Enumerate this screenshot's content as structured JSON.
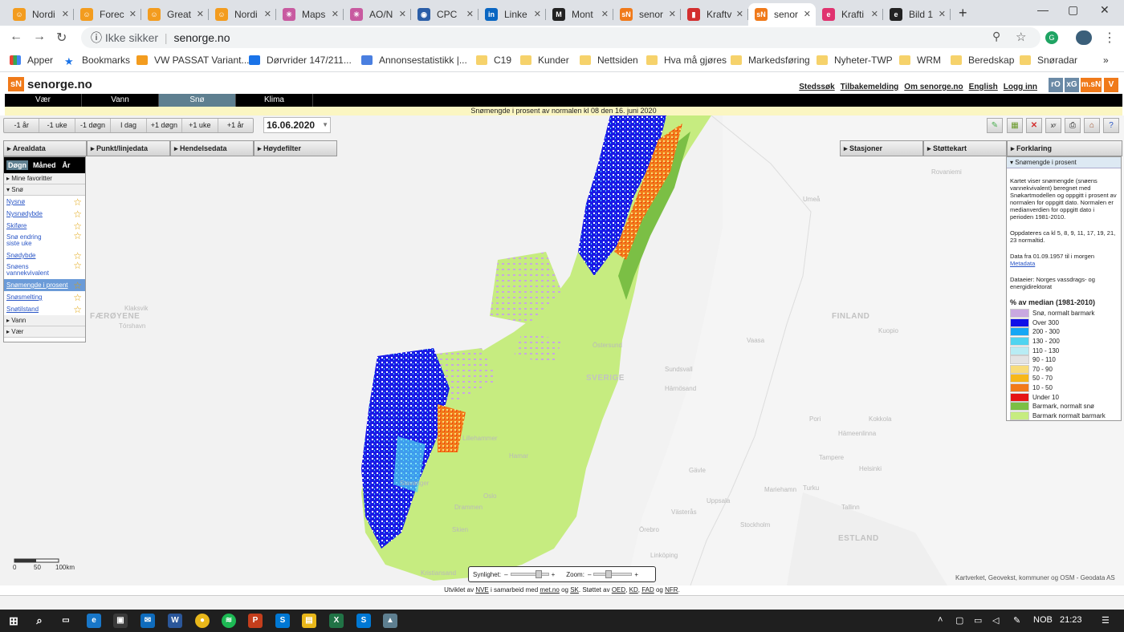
{
  "browser": {
    "tabs": [
      {
        "label": "Nordi",
        "color": "#f39c1f",
        "glyph": "☺"
      },
      {
        "label": "Forec",
        "color": "#f39c1f",
        "glyph": "☺"
      },
      {
        "label": "Great",
        "color": "#f39c1f",
        "glyph": "☺"
      },
      {
        "label": "Nordi",
        "color": "#f39c1f",
        "glyph": "☺"
      },
      {
        "label": "Maps",
        "color": "#c85aa0",
        "glyph": "✳"
      },
      {
        "label": "AO/N",
        "color": "#c85aa0",
        "glyph": "✳"
      },
      {
        "label": "CPC",
        "color": "#2b5ea7",
        "glyph": "◉"
      },
      {
        "label": "Linke",
        "color": "#0a66c2",
        "glyph": "in"
      },
      {
        "label": "Mont",
        "color": "#222222",
        "glyph": "M"
      },
      {
        "label": "senor",
        "color": "#f07a1a",
        "glyph": "sN"
      },
      {
        "label": "Kraftv",
        "color": "#d32f2f",
        "glyph": "▮"
      },
      {
        "label": "senor",
        "color": "#f07a1a",
        "glyph": "sN",
        "active": true
      },
      {
        "label": "Krafti",
        "color": "#e0326f",
        "glyph": "e"
      },
      {
        "label": "Bild 1",
        "color": "#222222",
        "glyph": "e"
      }
    ],
    "new_tab": "+",
    "url_warning": "Ikke sikker",
    "url": "senorge.no",
    "bookmarks": [
      {
        "label": "Apper",
        "kind": "apps"
      },
      {
        "label": "Bookmarks",
        "kind": "star"
      },
      {
        "label": "VW PASSAT Variant...",
        "kind": "E"
      },
      {
        "label": "Dørvrider 147/211...",
        "kind": "blue"
      },
      {
        "label": "Annonsestatistikk |...",
        "kind": "blue2"
      },
      {
        "label": "C19",
        "kind": "folder"
      },
      {
        "label": "Kunder",
        "kind": "folder"
      },
      {
        "label": "Nettsiden",
        "kind": "folder"
      },
      {
        "label": "Hva må gjøres",
        "kind": "folder"
      },
      {
        "label": "Markedsføring",
        "kind": "folder"
      },
      {
        "label": "Nyheter-TWP",
        "kind": "folder"
      },
      {
        "label": "WRM",
        "kind": "folder"
      },
      {
        "label": "Beredskap",
        "kind": "folder"
      },
      {
        "label": "Snøradar",
        "kind": "folder"
      }
    ],
    "more_bookmarks": "»"
  },
  "site": {
    "logo_text": "senorge.no",
    "logo_badge": "sN",
    "top_links": [
      "Stedssøk",
      "Tilbakemelding",
      "Om senorge.no",
      "English",
      "Logg inn"
    ],
    "brand_boxes": [
      {
        "label": "rO",
        "color": "#6b8aa6"
      },
      {
        "label": "xG",
        "color": "#6b8aa6"
      },
      {
        "label": "m.sN",
        "color": "#f07a1a"
      },
      {
        "label": "V",
        "color": "#f07a1a"
      }
    ],
    "main_nav": [
      "Vær",
      "Vann",
      "Snø",
      "Klima"
    ],
    "active_nav": "Snø",
    "info_bar": "Snømengde i prosent av normalen kl 08  den 16. juni 2020",
    "date_buttons": [
      "-1 år",
      "-1 uke",
      "-1 døgn",
      "I dag",
      "+1 døgn",
      "+1 uke",
      "+1 år"
    ],
    "date_value": "16.06.2020",
    "left_tabs": [
      "Arealdata",
      "Punkt/linjedata",
      "Hendelsedata",
      "Høydefilter"
    ],
    "right_tabs": [
      "Stasjoner",
      "Støttekart",
      "Forklaring"
    ],
    "period": {
      "options": [
        "Døgn",
        "Måned",
        "År"
      ],
      "selected": "Døgn"
    },
    "favorites_label": "Mine favoritter",
    "snow_section": "Snø",
    "snow_items": [
      "Nysnø",
      "Nysnødybde",
      "Skiføre",
      "Snø endring siste uke",
      "Snødybde",
      "Snøens vannekvivalent",
      "Snømengde i prosent",
      "Snøsmelting",
      "Snøtilstand"
    ],
    "selected_item": "Snømengde i prosent",
    "water_section": "Vann",
    "weather_section": "Vær",
    "explanation": {
      "title": "Snømengde i prosent",
      "p1": "Kartet viser snømengde (snøens vannekvivalent) beregnet med Snøkartmodellen og oppgitt i prosent av normalen for oppgitt dato. Normalen er medianverdien for oppgitt dato i perioden 1981-2010.",
      "p2": "Oppdateres ca kl 5, 8, 9, 11, 17, 19, 21, 23 normaltid.",
      "p3": "Data fra 01.09.1957 til i morgen",
      "metadata_link": "Metadata",
      "p4": "Dataeier: Norges vassdrags- og energidirektorat",
      "legend_title": "% av median (1981-2010)",
      "legend": [
        {
          "label": "Snø, normalt barmark",
          "color": "#c9a8e0"
        },
        {
          "label": "Over 300",
          "color": "#1010e8"
        },
        {
          "label": "200 - 300",
          "color": "#15a7f5"
        },
        {
          "label": "130 - 200",
          "color": "#4fd4f0"
        },
        {
          "label": "110 - 130",
          "color": "#b8ecf4"
        },
        {
          "label": "90 - 110",
          "color": "#e3e3e3"
        },
        {
          "label": "70 - 90",
          "color": "#f8dc7a"
        },
        {
          "label": "50 - 70",
          "color": "#f7b718"
        },
        {
          "label": "10 - 50",
          "color": "#f27a1a"
        },
        {
          "label": "Under 10",
          "color": "#e51515"
        },
        {
          "label": "Barmark, normalt snø",
          "color": "#7bbf45"
        },
        {
          "label": "Barmark normalt barmark",
          "color": "#c6ec80"
        }
      ]
    },
    "map_labels": [
      "Klaksvik",
      "Tórshavn",
      "FÆRØYENE",
      "SVERIGE",
      "FINLAND",
      "ESTLAND",
      "Lillehammer",
      "Hamar",
      "Oslo",
      "Drammen",
      "Skien",
      "Kristiansand",
      "Stavanger",
      "Östersund",
      "Sundsvall",
      "Härnösand",
      "Gävle",
      "Uppsala",
      "Stockholm",
      "Vaasa",
      "Kuopio",
      "Tampere",
      "Helsinki",
      "Tallinn",
      "Umeå",
      "Rovaniemi",
      "Kokkola",
      "Pori",
      "Turku",
      "Hämeenlinna",
      "Linköping",
      "Örebro",
      "Västerås",
      "Mariehamn"
    ],
    "scale": {
      "zero": "0",
      "mid": "50",
      "end": "100km"
    },
    "opacity_label": "Synlighet:",
    "zoom_label": "Zoom:",
    "opacity_value": 0.75,
    "zoom_value": 0.35,
    "attribution": "Kartverket, Geovekst, kommuner og OSM - Geodata AS",
    "footer": {
      "prefix": "Utviklet av",
      "nve": "NVE",
      "mid": "i samarbeid med",
      "met": "met.no",
      "og1": "og",
      "sk": "SK",
      "supported": ". Støttet av",
      "oed": "OED",
      "kd": "KD",
      "fad": "FAD",
      "og2": "og",
      "nfr": "NFR"
    }
  },
  "taskbar": {
    "language": "NOB",
    "time": "21:23"
  }
}
